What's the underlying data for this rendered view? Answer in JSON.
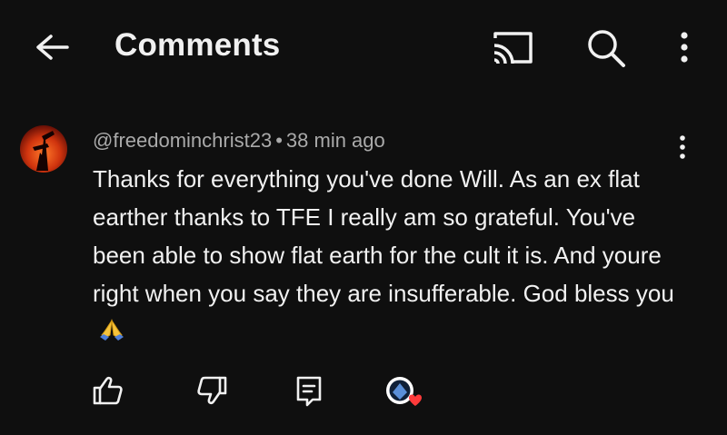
{
  "header": {
    "title": "Comments",
    "icons": {
      "back": "arrow-left-icon",
      "cast": "cast-icon",
      "search": "search-icon",
      "more": "more-vertical-icon"
    }
  },
  "comment": {
    "author": "@freedominchrist23",
    "separator": "•",
    "time": "38 min ago",
    "text": "Thanks for everything you've done Will. As an ex flat earther thanks to TFE I really am so grateful. You've been able to show flat earth for the cult it is. And youre right when you say they are insufferable. God bless you",
    "emoji": "folded-hands-icon",
    "actions": {
      "like": "thumbs-up-icon",
      "dislike": "thumbs-down-icon",
      "reply": "reply-icon",
      "creator_heart": "creator-heart-icon"
    },
    "heart_color": "#ff3b3b"
  }
}
